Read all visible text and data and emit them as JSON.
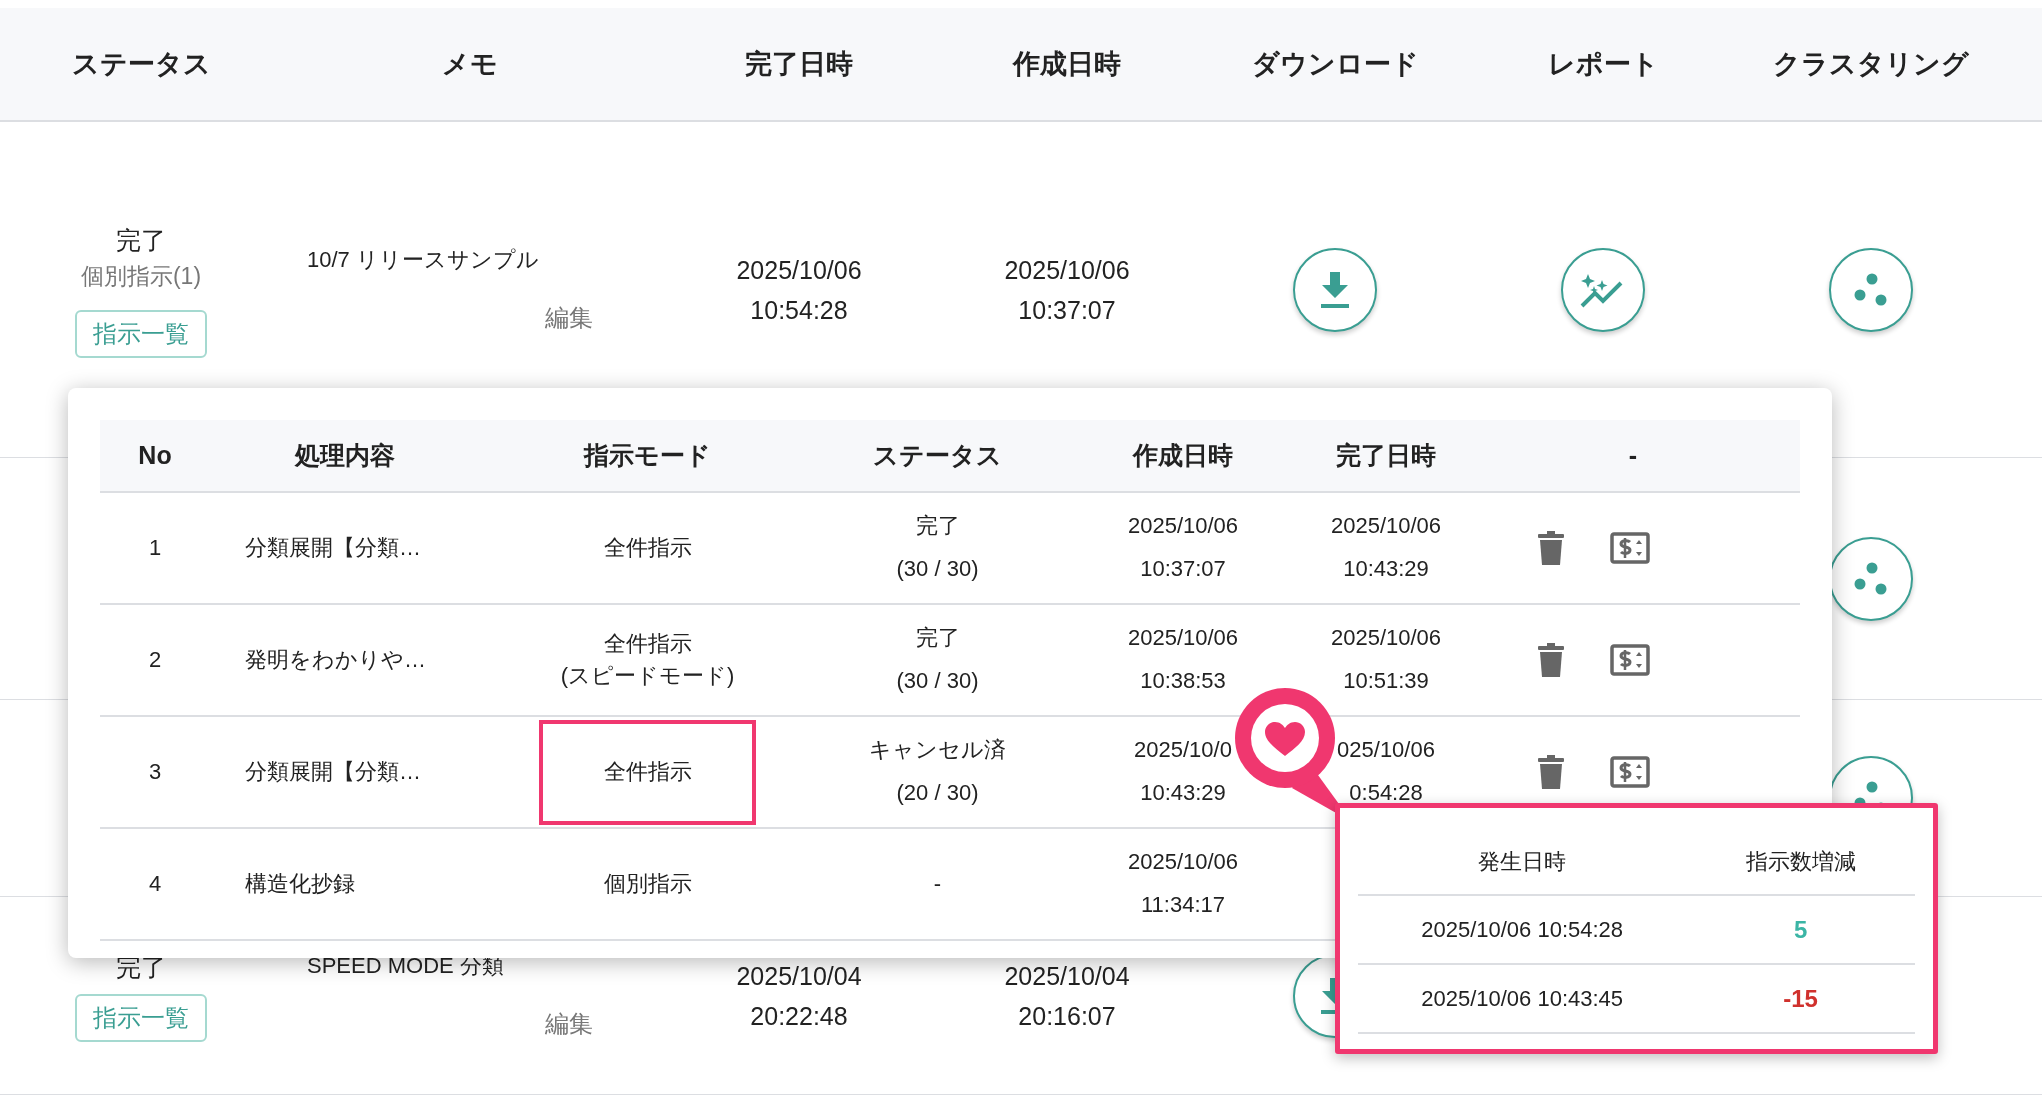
{
  "main_table": {
    "columns": [
      "ステータス",
      "メモ",
      "完了日時",
      "作成日時",
      "ダウンロード",
      "レポート",
      "クラスタリング"
    ],
    "rows": [
      {
        "kind": "full",
        "status": "完了",
        "mode": "個別指示(1)",
        "list_button": "指示一覧",
        "memo": "10/7 リリースサンプル",
        "edit": "編集",
        "completed": [
          "2025/10/06",
          "10:54:28"
        ],
        "created": [
          "2025/10/06",
          "10:37:07"
        ]
      },
      {
        "kind": "covered"
      },
      {
        "kind": "covered"
      },
      {
        "kind": "partial",
        "status": "完了",
        "list_button": "指示一覧",
        "memo": "SPEED MODE 分類",
        "edit": "編集",
        "completed": [
          "2025/10/04",
          "20:22:48"
        ],
        "created": [
          "2025/10/04",
          "20:16:07"
        ]
      }
    ]
  },
  "instruction_popup": {
    "columns": [
      "No",
      "処理内容",
      "指示モード",
      "ステータス",
      "作成日時",
      "完了日時",
      "-"
    ],
    "rows": [
      {
        "kind": "full",
        "no": "1",
        "content": "分類展開【分類…",
        "mode": [
          "全件指示"
        ],
        "highlighted": false,
        "status": [
          "完了",
          "(30 / 30)"
        ],
        "created": [
          "2025/10/06",
          "10:37:07"
        ],
        "completed": [
          "2025/10/06",
          "10:43:29"
        ]
      },
      {
        "kind": "full",
        "no": "2",
        "content": "発明をわかりや…",
        "mode": [
          "全件指示",
          "(スピードモード)"
        ],
        "highlighted": false,
        "status": [
          "完了",
          "(30 / 30)"
        ],
        "created": [
          "2025/10/06",
          "10:38:53"
        ],
        "completed": [
          "2025/10/06",
          "10:51:39"
        ]
      },
      {
        "kind": "full",
        "no": "3",
        "content": "分類展開【分類…",
        "mode": [
          "全件指示"
        ],
        "highlighted": true,
        "status": [
          "キャンセル済",
          "(20 / 30)"
        ],
        "created": [
          "2025/10/0",
          "10:43:29"
        ],
        "completed": [
          "025/10/06",
          "0:54:28"
        ]
      },
      {
        "kind": "partial",
        "no": "4",
        "content": "構造化抄録",
        "mode": [
          "個別指示"
        ],
        "highlighted": false,
        "status": [
          "-"
        ],
        "created": [
          "2025/10/06",
          "11:34:17"
        ],
        "completed": []
      }
    ]
  },
  "callout": {
    "columns": [
      "発生日時",
      "指示数増減"
    ],
    "rows": [
      {
        "time": "2025/10/06 10:54:28",
        "change": "5",
        "color": "#3bb5a5"
      },
      {
        "time": "2025/10/06 10:43:45",
        "change": "-15",
        "color": "#d0312d"
      }
    ]
  }
}
